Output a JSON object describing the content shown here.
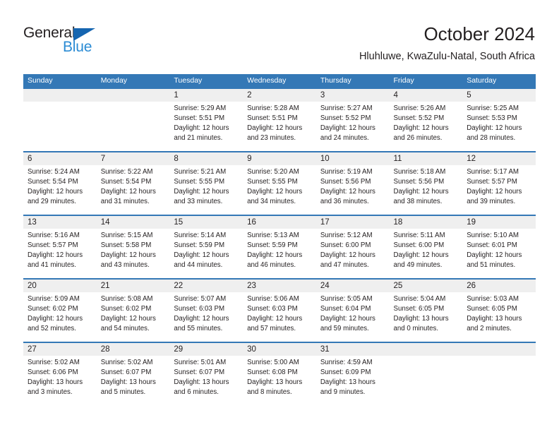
{
  "brand": {
    "name_part1": "General",
    "name_part2": "Blue",
    "color_dark": "#231f20",
    "color_blue": "#2a8bd4",
    "triangle_color": "#1565b0"
  },
  "header": {
    "title": "October 2024",
    "subtitle": "Hluhluwe, KwaZulu-Natal, South Africa"
  },
  "theme": {
    "header_bg": "#3478b6",
    "header_text": "#ffffff",
    "daynum_bg": "#efefef",
    "cell_bg": "#ffffff",
    "text": "#231f20"
  },
  "weekdays": [
    "Sunday",
    "Monday",
    "Tuesday",
    "Wednesday",
    "Thursday",
    "Friday",
    "Saturday"
  ],
  "weeks": [
    {
      "days": [
        {
          "num": "",
          "lines": [
            "",
            "",
            "",
            ""
          ]
        },
        {
          "num": "",
          "lines": [
            "",
            "",
            "",
            ""
          ]
        },
        {
          "num": "1",
          "lines": [
            "Sunrise: 5:29 AM",
            "Sunset: 5:51 PM",
            "Daylight: 12 hours",
            "and 21 minutes."
          ]
        },
        {
          "num": "2",
          "lines": [
            "Sunrise: 5:28 AM",
            "Sunset: 5:51 PM",
            "Daylight: 12 hours",
            "and 23 minutes."
          ]
        },
        {
          "num": "3",
          "lines": [
            "Sunrise: 5:27 AM",
            "Sunset: 5:52 PM",
            "Daylight: 12 hours",
            "and 24 minutes."
          ]
        },
        {
          "num": "4",
          "lines": [
            "Sunrise: 5:26 AM",
            "Sunset: 5:52 PM",
            "Daylight: 12 hours",
            "and 26 minutes."
          ]
        },
        {
          "num": "5",
          "lines": [
            "Sunrise: 5:25 AM",
            "Sunset: 5:53 PM",
            "Daylight: 12 hours",
            "and 28 minutes."
          ]
        }
      ]
    },
    {
      "days": [
        {
          "num": "6",
          "lines": [
            "Sunrise: 5:24 AM",
            "Sunset: 5:54 PM",
            "Daylight: 12 hours",
            "and 29 minutes."
          ]
        },
        {
          "num": "7",
          "lines": [
            "Sunrise: 5:22 AM",
            "Sunset: 5:54 PM",
            "Daylight: 12 hours",
            "and 31 minutes."
          ]
        },
        {
          "num": "8",
          "lines": [
            "Sunrise: 5:21 AM",
            "Sunset: 5:55 PM",
            "Daylight: 12 hours",
            "and 33 minutes."
          ]
        },
        {
          "num": "9",
          "lines": [
            "Sunrise: 5:20 AM",
            "Sunset: 5:55 PM",
            "Daylight: 12 hours",
            "and 34 minutes."
          ]
        },
        {
          "num": "10",
          "lines": [
            "Sunrise: 5:19 AM",
            "Sunset: 5:56 PM",
            "Daylight: 12 hours",
            "and 36 minutes."
          ]
        },
        {
          "num": "11",
          "lines": [
            "Sunrise: 5:18 AM",
            "Sunset: 5:56 PM",
            "Daylight: 12 hours",
            "and 38 minutes."
          ]
        },
        {
          "num": "12",
          "lines": [
            "Sunrise: 5:17 AM",
            "Sunset: 5:57 PM",
            "Daylight: 12 hours",
            "and 39 minutes."
          ]
        }
      ]
    },
    {
      "days": [
        {
          "num": "13",
          "lines": [
            "Sunrise: 5:16 AM",
            "Sunset: 5:57 PM",
            "Daylight: 12 hours",
            "and 41 minutes."
          ]
        },
        {
          "num": "14",
          "lines": [
            "Sunrise: 5:15 AM",
            "Sunset: 5:58 PM",
            "Daylight: 12 hours",
            "and 43 minutes."
          ]
        },
        {
          "num": "15",
          "lines": [
            "Sunrise: 5:14 AM",
            "Sunset: 5:59 PM",
            "Daylight: 12 hours",
            "and 44 minutes."
          ]
        },
        {
          "num": "16",
          "lines": [
            "Sunrise: 5:13 AM",
            "Sunset: 5:59 PM",
            "Daylight: 12 hours",
            "and 46 minutes."
          ]
        },
        {
          "num": "17",
          "lines": [
            "Sunrise: 5:12 AM",
            "Sunset: 6:00 PM",
            "Daylight: 12 hours",
            "and 47 minutes."
          ]
        },
        {
          "num": "18",
          "lines": [
            "Sunrise: 5:11 AM",
            "Sunset: 6:00 PM",
            "Daylight: 12 hours",
            "and 49 minutes."
          ]
        },
        {
          "num": "19",
          "lines": [
            "Sunrise: 5:10 AM",
            "Sunset: 6:01 PM",
            "Daylight: 12 hours",
            "and 51 minutes."
          ]
        }
      ]
    },
    {
      "days": [
        {
          "num": "20",
          "lines": [
            "Sunrise: 5:09 AM",
            "Sunset: 6:02 PM",
            "Daylight: 12 hours",
            "and 52 minutes."
          ]
        },
        {
          "num": "21",
          "lines": [
            "Sunrise: 5:08 AM",
            "Sunset: 6:02 PM",
            "Daylight: 12 hours",
            "and 54 minutes."
          ]
        },
        {
          "num": "22",
          "lines": [
            "Sunrise: 5:07 AM",
            "Sunset: 6:03 PM",
            "Daylight: 12 hours",
            "and 55 minutes."
          ]
        },
        {
          "num": "23",
          "lines": [
            "Sunrise: 5:06 AM",
            "Sunset: 6:03 PM",
            "Daylight: 12 hours",
            "and 57 minutes."
          ]
        },
        {
          "num": "24",
          "lines": [
            "Sunrise: 5:05 AM",
            "Sunset: 6:04 PM",
            "Daylight: 12 hours",
            "and 59 minutes."
          ]
        },
        {
          "num": "25",
          "lines": [
            "Sunrise: 5:04 AM",
            "Sunset: 6:05 PM",
            "Daylight: 13 hours",
            "and 0 minutes."
          ]
        },
        {
          "num": "26",
          "lines": [
            "Sunrise: 5:03 AM",
            "Sunset: 6:05 PM",
            "Daylight: 13 hours",
            "and 2 minutes."
          ]
        }
      ]
    },
    {
      "days": [
        {
          "num": "27",
          "lines": [
            "Sunrise: 5:02 AM",
            "Sunset: 6:06 PM",
            "Daylight: 13 hours",
            "and 3 minutes."
          ]
        },
        {
          "num": "28",
          "lines": [
            "Sunrise: 5:02 AM",
            "Sunset: 6:07 PM",
            "Daylight: 13 hours",
            "and 5 minutes."
          ]
        },
        {
          "num": "29",
          "lines": [
            "Sunrise: 5:01 AM",
            "Sunset: 6:07 PM",
            "Daylight: 13 hours",
            "and 6 minutes."
          ]
        },
        {
          "num": "30",
          "lines": [
            "Sunrise: 5:00 AM",
            "Sunset: 6:08 PM",
            "Daylight: 13 hours",
            "and 8 minutes."
          ]
        },
        {
          "num": "31",
          "lines": [
            "Sunrise: 4:59 AM",
            "Sunset: 6:09 PM",
            "Daylight: 13 hours",
            "and 9 minutes."
          ]
        },
        {
          "num": "",
          "lines": [
            "",
            "",
            "",
            ""
          ]
        },
        {
          "num": "",
          "lines": [
            "",
            "",
            "",
            ""
          ]
        }
      ]
    }
  ]
}
